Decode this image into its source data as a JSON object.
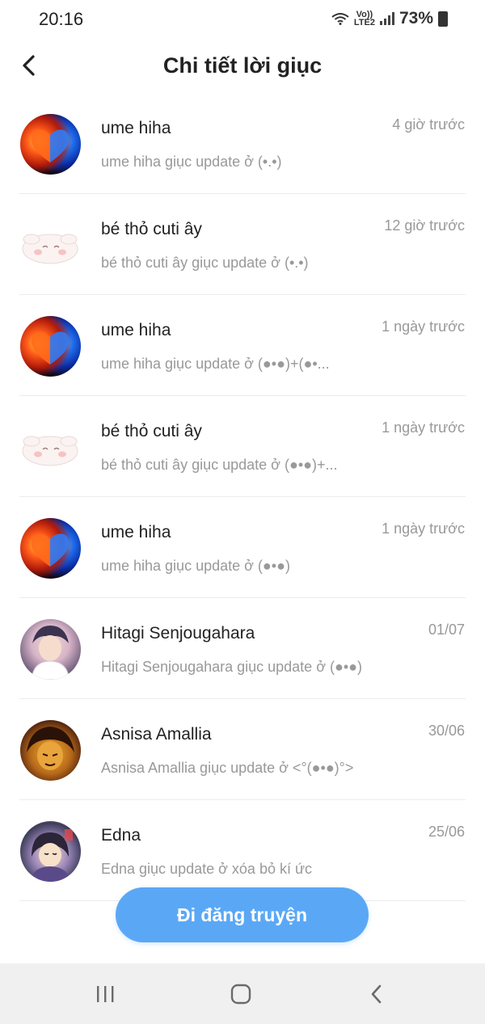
{
  "status_bar": {
    "time": "20:16",
    "network_top": "Vo))",
    "network_bottom": "LTE2",
    "battery": "73%"
  },
  "header": {
    "title": "Chi tiết lời giục",
    "back_icon": "chevron-left-icon"
  },
  "items": [
    {
      "name": "ume hiha",
      "time": "4 giờ trước",
      "message": "ume hiha giục update ở (•.•)",
      "avatar": "fire-heart"
    },
    {
      "name": "bé thỏ cuti ây",
      "time": "12 giờ trước",
      "message": "bé thỏ cuti ây giục update ở (•.•)",
      "avatar": "bunny"
    },
    {
      "name": "ume hiha",
      "time": "1 ngày trước",
      "message": "ume hiha giục update ở (●•●)+(●•...",
      "avatar": "fire-heart"
    },
    {
      "name": "bé thỏ cuti ây",
      "time": "1 ngày trước",
      "message": "bé thỏ cuti ây giục update ở (●•●)+...",
      "avatar": "bunny"
    },
    {
      "name": "ume hiha",
      "time": "1 ngày trước",
      "message": "ume hiha giục update ở (●•●)",
      "avatar": "fire-heart"
    },
    {
      "name": "Hitagi Senjougahara",
      "time": "01/07",
      "message": "Hitagi Senjougahara  giục update ở (●•●)",
      "avatar": "anime-boy"
    },
    {
      "name": "Asnisa Amallia",
      "time": "30/06",
      "message": "Asnisa Amallia giục update ở <°(●•●)°>",
      "avatar": "manga-face"
    },
    {
      "name": "Edna",
      "time": "25/06",
      "message": "Edna giục update ở xóa bỏ kí ức",
      "avatar": "anime-girl"
    }
  ],
  "cta": {
    "label": "Đi đăng truyện"
  },
  "colors": {
    "accent": "#5aa8f5",
    "muted_text": "#999999",
    "title_text": "#222222"
  }
}
